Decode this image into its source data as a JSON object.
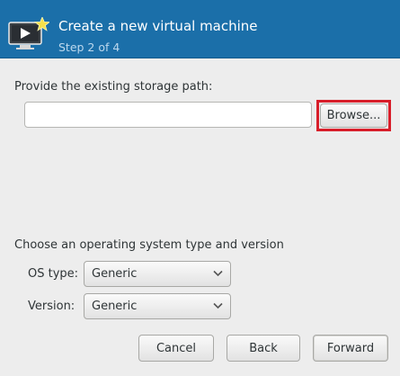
{
  "header": {
    "title": "Create a new virtual machine",
    "step": "Step 2 of 4",
    "icon": "vm-create-icon",
    "background": "#1b6fa9"
  },
  "storage": {
    "label": "Provide the existing storage path:",
    "path_value": "",
    "path_placeholder": "",
    "browse_label": "Browse...",
    "highlight_color": "#d81e2a"
  },
  "os": {
    "label": "Choose an operating system type and version",
    "type_label": "OS type:",
    "type_value": "Generic",
    "version_label": "Version:",
    "version_value": "Generic"
  },
  "buttons": {
    "cancel": "Cancel",
    "back": "Back",
    "forward": "Forward"
  }
}
